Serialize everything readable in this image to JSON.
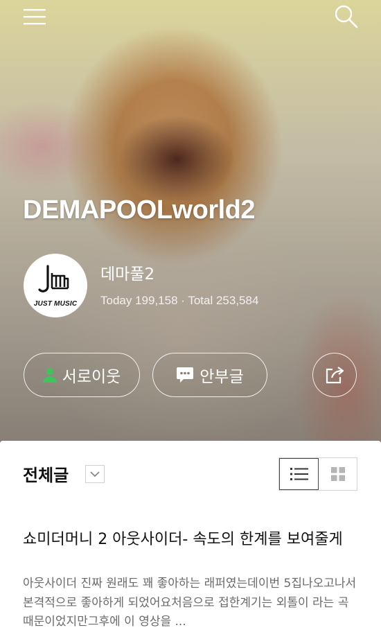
{
  "header": {
    "menu_icon": "hamburger-menu-icon",
    "search_icon": "search-icon"
  },
  "blog": {
    "title": "DEMAPOOLworld2",
    "nickname": "데마풀2",
    "stats": "Today 199,158 · Total 253,584",
    "avatar_text": "JUST MUSIC"
  },
  "actions": {
    "neighbor_label": "서로이웃",
    "guest_label": "안부글",
    "share_icon": "share-icon"
  },
  "section": {
    "title": "전체글",
    "view_list_icon": "list-view-icon",
    "view_grid_icon": "grid-view-icon"
  },
  "post": {
    "title": "쇼미더머니 2 아웃사이더- 속도의 한계를 보여줄게",
    "excerpt": "아웃사이더 진짜 원래도 꽤 좋아하는 래퍼였는데이번 5집나오고나서 본격적으로 좋아하게 되었어요처음으로 접한계기는 외톨이 라는 곡 때문이었지만그후에 이 영상을 ..."
  },
  "colors": {
    "neighbor_icon": "#3ec45a",
    "card_bg": "#ffffff",
    "hero_text": "#ffffff"
  }
}
